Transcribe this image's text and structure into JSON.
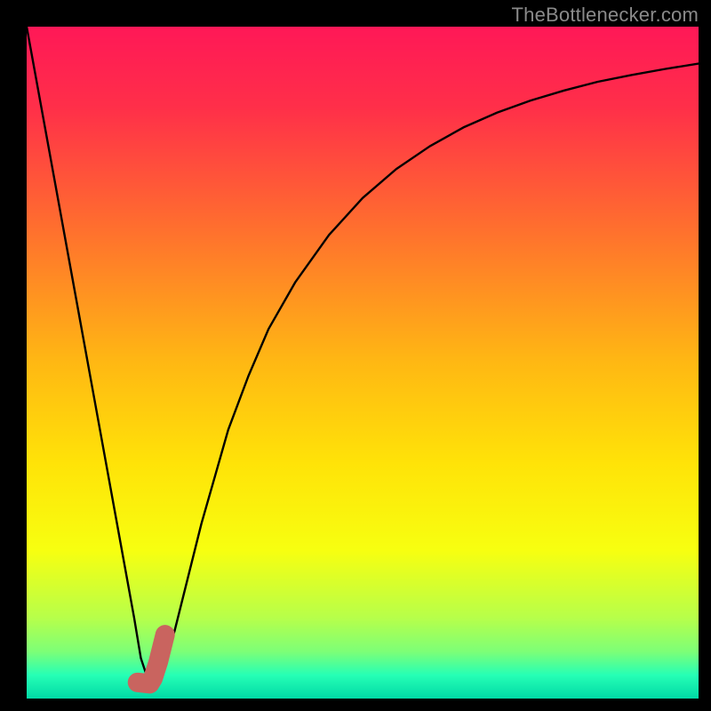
{
  "watermark": "TheBottlenecker.com",
  "colors": {
    "frame": "#000000",
    "curve": "#000000",
    "marker": "#c9645f",
    "gradient_stops": [
      {
        "offset": 0.0,
        "color": "#ff1857"
      },
      {
        "offset": 0.12,
        "color": "#ff2f49"
      },
      {
        "offset": 0.3,
        "color": "#ff6f2e"
      },
      {
        "offset": 0.5,
        "color": "#ffb813"
      },
      {
        "offset": 0.65,
        "color": "#ffe308"
      },
      {
        "offset": 0.78,
        "color": "#f7ff10"
      },
      {
        "offset": 0.88,
        "color": "#b7ff4a"
      },
      {
        "offset": 0.93,
        "color": "#7dff77"
      },
      {
        "offset": 0.965,
        "color": "#26ffb5"
      },
      {
        "offset": 1.0,
        "color": "#00d9a6"
      }
    ]
  },
  "chart_data": {
    "type": "line",
    "title": "",
    "xlabel": "",
    "ylabel": "",
    "xlim": [
      0,
      100
    ],
    "ylim": [
      0,
      100
    ],
    "grid": false,
    "legend": false,
    "series": [
      {
        "name": "bottleneck-curve",
        "x": [
          0,
          2,
          4,
          6,
          8,
          10,
          12,
          14,
          16,
          17,
          18,
          19,
          20,
          22,
          24,
          26,
          28,
          30,
          33,
          36,
          40,
          45,
          50,
          55,
          60,
          65,
          70,
          75,
          80,
          85,
          90,
          95,
          100
        ],
        "y": [
          100,
          89,
          78,
          67,
          56,
          45,
          34,
          23,
          12,
          6,
          3,
          2.5,
          4,
          10,
          18,
          26,
          33,
          40,
          48,
          55,
          62,
          69,
          74.5,
          78.8,
          82.2,
          85,
          87.2,
          89,
          90.5,
          91.8,
          92.8,
          93.7,
          94.5
        ]
      }
    ],
    "marker": {
      "name": "optimal-point",
      "shape": "j-hook",
      "points": [
        {
          "x": 16.5,
          "y": 2.4
        },
        {
          "x": 18.3,
          "y": 2.2
        },
        {
          "x": 18.8,
          "y": 3.0
        },
        {
          "x": 19.6,
          "y": 5.5
        },
        {
          "x": 20.6,
          "y": 9.5
        }
      ]
    }
  }
}
